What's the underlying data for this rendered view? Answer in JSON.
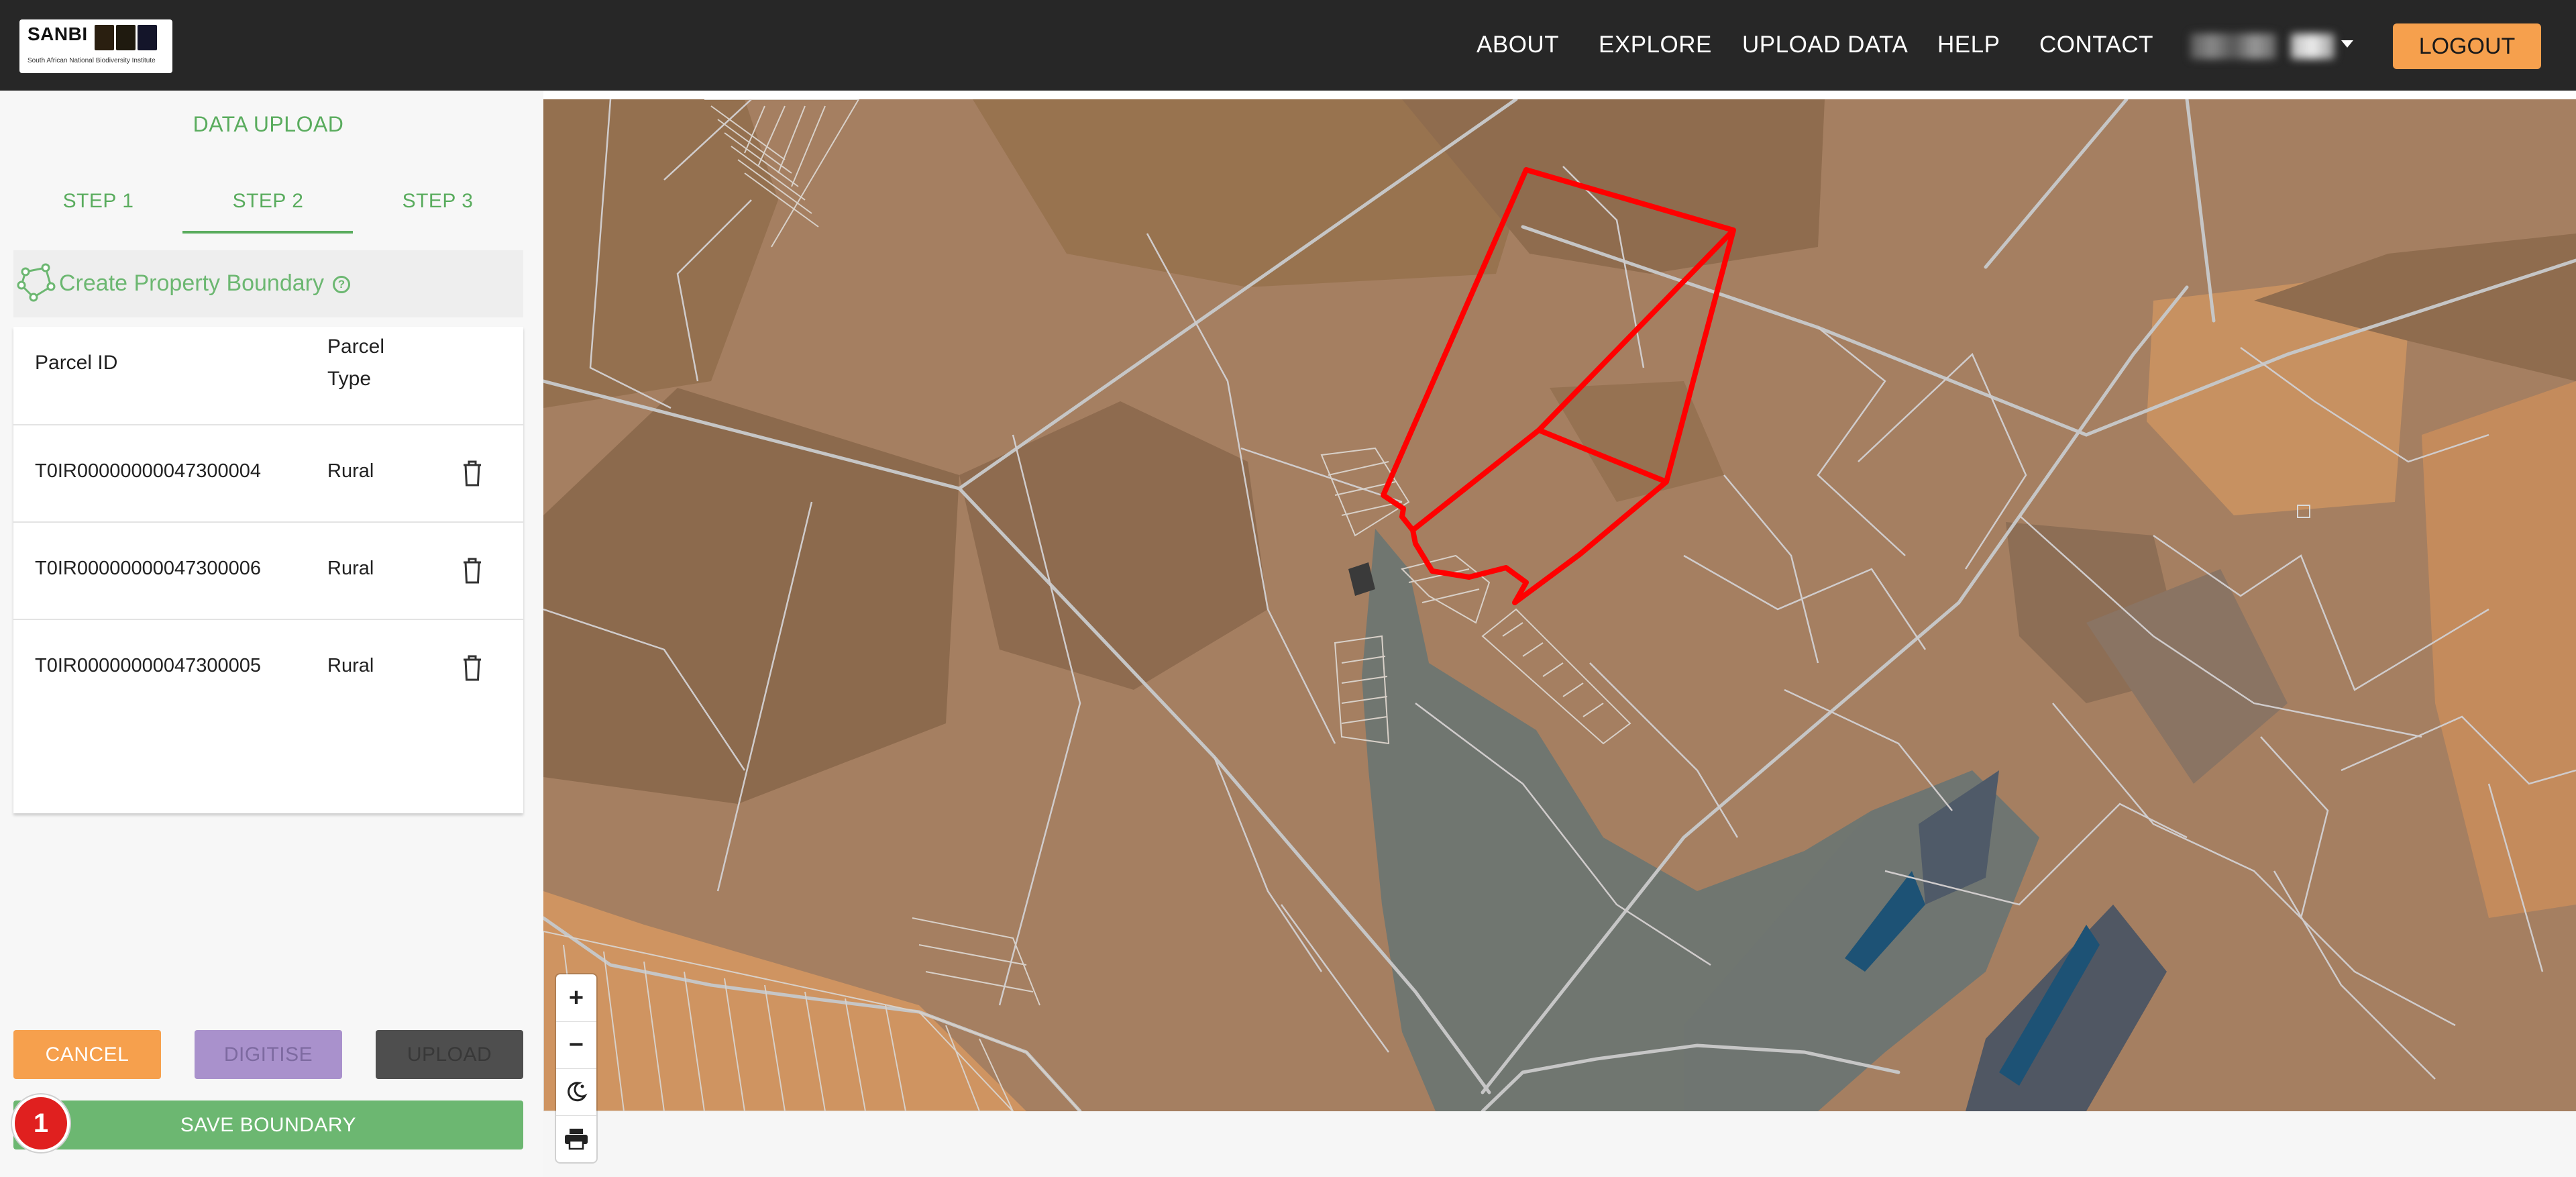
{
  "navbar": {
    "logo_text": "SANBI",
    "logo_subtitle": "South African National Biodiversity Institute",
    "links": [
      "ABOUT",
      "EXPLORE",
      "UPLOAD DATA",
      "HELP",
      "CONTACT"
    ],
    "logout_label": "LOGOUT",
    "accent_color": "#f6a04d",
    "background_color": "#272727"
  },
  "sidebar": {
    "title": "DATA UPLOAD",
    "steps": [
      "STEP 1",
      "STEP 2",
      "STEP 3"
    ],
    "active_step": "STEP 2",
    "boundary_label": "Create Property Boundary",
    "boundary_help_icon": "help-circle-icon",
    "table": {
      "headers": [
        "Parcel ID",
        "Parcel Type"
      ],
      "rows": [
        {
          "parcel_id": "T0IR00000000047300004",
          "parcel_type": "Rural"
        },
        {
          "parcel_id": "T0IR00000000047300006",
          "parcel_type": "Rural"
        },
        {
          "parcel_id": "T0IR00000000047300005",
          "parcel_type": "Rural"
        }
      ]
    },
    "buttons": {
      "cancel": "CANCEL",
      "digitise": "DIGITISE",
      "upload": "UPLOAD",
      "save_boundary": "SAVE BOUNDARY"
    },
    "badge": "1",
    "green_color": "#6cb771",
    "purple_color": "#a991cc"
  },
  "map": {
    "controls": [
      "zoom-in-icon",
      "zoom-out-icon",
      "theme-toggle-icon",
      "print-icon"
    ],
    "boundary_color": "#ff0000"
  }
}
